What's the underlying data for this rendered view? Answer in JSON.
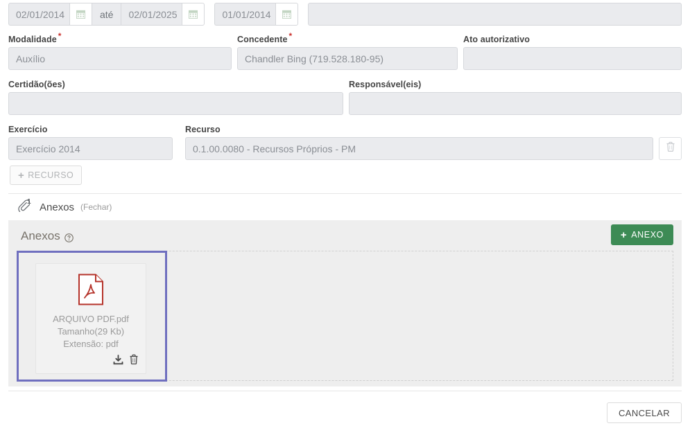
{
  "date_range": {
    "start_value": "02/01/2014",
    "separator_label": "até",
    "end_value": "02/01/2025",
    "third_value": "01/01/2014",
    "calendar_icon": "calendar-icon",
    "trailing_field_value": ""
  },
  "fields": {
    "modalidade": {
      "label": "Modalidade",
      "required": true,
      "value": "Auxílio"
    },
    "concedente": {
      "label": "Concedente",
      "required": true,
      "value": "Chandler Bing (719.528.180-95)"
    },
    "ato_autorizativo": {
      "label": "Ato autorizativo",
      "required": false,
      "value": ""
    },
    "certidoes": {
      "label": "Certidão(ões)",
      "required": false,
      "value": ""
    },
    "responsaveis": {
      "label": "Responsável(eis)",
      "required": false,
      "value": ""
    },
    "exercicio": {
      "label": "Exercício",
      "required": false,
      "value": "Exercício 2014"
    },
    "recurso": {
      "label": "Recurso",
      "required": false,
      "value": "0.1.00.0080 - Recursos Próprios - PM"
    }
  },
  "recurso_row": {
    "delete_icon": "trash-icon"
  },
  "add_resource_button": {
    "label": "RECURSO",
    "plus": "+"
  },
  "anexos_toggle": {
    "icon": "paperclip-icon",
    "badge": "1",
    "label": "Anexos",
    "close_link": "(Fechar)"
  },
  "anexos_panel": {
    "title": "Anexos",
    "help_icon": "help-circle-icon",
    "add_button": {
      "label": "ANEXO",
      "plus": "+",
      "color": "#3d8b55"
    },
    "selection_color": "#6f6fbf",
    "files": [
      {
        "icon": "pdf-file-icon",
        "name": "ARQUIVO PDF.pdf",
        "size": "Tamanho(29 Kb)",
        "extension": "Extensão: pdf",
        "download_icon": "download-icon",
        "delete_icon": "trash-icon",
        "selected": true
      }
    ]
  },
  "footer": {
    "cancel_label": "CANCELAR"
  }
}
